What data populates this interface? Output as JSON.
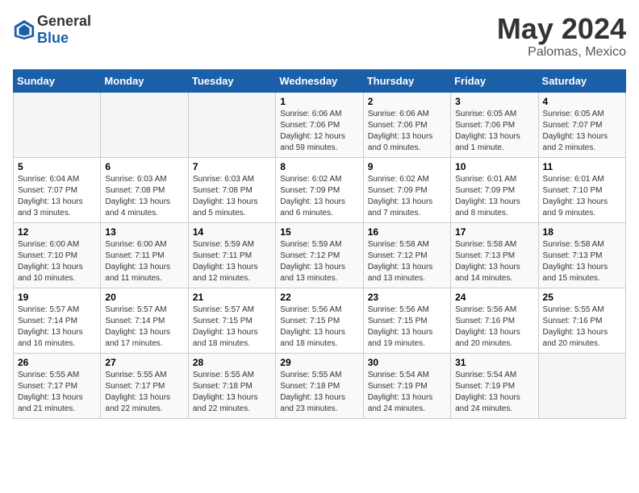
{
  "header": {
    "logo": {
      "general": "General",
      "blue": "Blue"
    },
    "month": "May 2024",
    "location": "Palomas, Mexico"
  },
  "weekdays": [
    "Sunday",
    "Monday",
    "Tuesday",
    "Wednesday",
    "Thursday",
    "Friday",
    "Saturday"
  ],
  "weeks": [
    [
      {
        "day": "",
        "content": ""
      },
      {
        "day": "",
        "content": ""
      },
      {
        "day": "",
        "content": ""
      },
      {
        "day": "1",
        "content": "Sunrise: 6:06 AM\nSunset: 7:06 PM\nDaylight: 12 hours\nand 59 minutes."
      },
      {
        "day": "2",
        "content": "Sunrise: 6:06 AM\nSunset: 7:06 PM\nDaylight: 13 hours\nand 0 minutes."
      },
      {
        "day": "3",
        "content": "Sunrise: 6:05 AM\nSunset: 7:06 PM\nDaylight: 13 hours\nand 1 minute."
      },
      {
        "day": "4",
        "content": "Sunrise: 6:05 AM\nSunset: 7:07 PM\nDaylight: 13 hours\nand 2 minutes."
      }
    ],
    [
      {
        "day": "5",
        "content": "Sunrise: 6:04 AM\nSunset: 7:07 PM\nDaylight: 13 hours\nand 3 minutes."
      },
      {
        "day": "6",
        "content": "Sunrise: 6:03 AM\nSunset: 7:08 PM\nDaylight: 13 hours\nand 4 minutes."
      },
      {
        "day": "7",
        "content": "Sunrise: 6:03 AM\nSunset: 7:08 PM\nDaylight: 13 hours\nand 5 minutes."
      },
      {
        "day": "8",
        "content": "Sunrise: 6:02 AM\nSunset: 7:09 PM\nDaylight: 13 hours\nand 6 minutes."
      },
      {
        "day": "9",
        "content": "Sunrise: 6:02 AM\nSunset: 7:09 PM\nDaylight: 13 hours\nand 7 minutes."
      },
      {
        "day": "10",
        "content": "Sunrise: 6:01 AM\nSunset: 7:09 PM\nDaylight: 13 hours\nand 8 minutes."
      },
      {
        "day": "11",
        "content": "Sunrise: 6:01 AM\nSunset: 7:10 PM\nDaylight: 13 hours\nand 9 minutes."
      }
    ],
    [
      {
        "day": "12",
        "content": "Sunrise: 6:00 AM\nSunset: 7:10 PM\nDaylight: 13 hours\nand 10 minutes."
      },
      {
        "day": "13",
        "content": "Sunrise: 6:00 AM\nSunset: 7:11 PM\nDaylight: 13 hours\nand 11 minutes."
      },
      {
        "day": "14",
        "content": "Sunrise: 5:59 AM\nSunset: 7:11 PM\nDaylight: 13 hours\nand 12 minutes."
      },
      {
        "day": "15",
        "content": "Sunrise: 5:59 AM\nSunset: 7:12 PM\nDaylight: 13 hours\nand 13 minutes."
      },
      {
        "day": "16",
        "content": "Sunrise: 5:58 AM\nSunset: 7:12 PM\nDaylight: 13 hours\nand 13 minutes."
      },
      {
        "day": "17",
        "content": "Sunrise: 5:58 AM\nSunset: 7:13 PM\nDaylight: 13 hours\nand 14 minutes."
      },
      {
        "day": "18",
        "content": "Sunrise: 5:58 AM\nSunset: 7:13 PM\nDaylight: 13 hours\nand 15 minutes."
      }
    ],
    [
      {
        "day": "19",
        "content": "Sunrise: 5:57 AM\nSunset: 7:14 PM\nDaylight: 13 hours\nand 16 minutes."
      },
      {
        "day": "20",
        "content": "Sunrise: 5:57 AM\nSunset: 7:14 PM\nDaylight: 13 hours\nand 17 minutes."
      },
      {
        "day": "21",
        "content": "Sunrise: 5:57 AM\nSunset: 7:15 PM\nDaylight: 13 hours\nand 18 minutes."
      },
      {
        "day": "22",
        "content": "Sunrise: 5:56 AM\nSunset: 7:15 PM\nDaylight: 13 hours\nand 18 minutes."
      },
      {
        "day": "23",
        "content": "Sunrise: 5:56 AM\nSunset: 7:15 PM\nDaylight: 13 hours\nand 19 minutes."
      },
      {
        "day": "24",
        "content": "Sunrise: 5:56 AM\nSunset: 7:16 PM\nDaylight: 13 hours\nand 20 minutes."
      },
      {
        "day": "25",
        "content": "Sunrise: 5:55 AM\nSunset: 7:16 PM\nDaylight: 13 hours\nand 20 minutes."
      }
    ],
    [
      {
        "day": "26",
        "content": "Sunrise: 5:55 AM\nSunset: 7:17 PM\nDaylight: 13 hours\nand 21 minutes."
      },
      {
        "day": "27",
        "content": "Sunrise: 5:55 AM\nSunset: 7:17 PM\nDaylight: 13 hours\nand 22 minutes."
      },
      {
        "day": "28",
        "content": "Sunrise: 5:55 AM\nSunset: 7:18 PM\nDaylight: 13 hours\nand 22 minutes."
      },
      {
        "day": "29",
        "content": "Sunrise: 5:55 AM\nSunset: 7:18 PM\nDaylight: 13 hours\nand 23 minutes."
      },
      {
        "day": "30",
        "content": "Sunrise: 5:54 AM\nSunset: 7:19 PM\nDaylight: 13 hours\nand 24 minutes."
      },
      {
        "day": "31",
        "content": "Sunrise: 5:54 AM\nSunset: 7:19 PM\nDaylight: 13 hours\nand 24 minutes."
      },
      {
        "day": "",
        "content": ""
      }
    ]
  ]
}
